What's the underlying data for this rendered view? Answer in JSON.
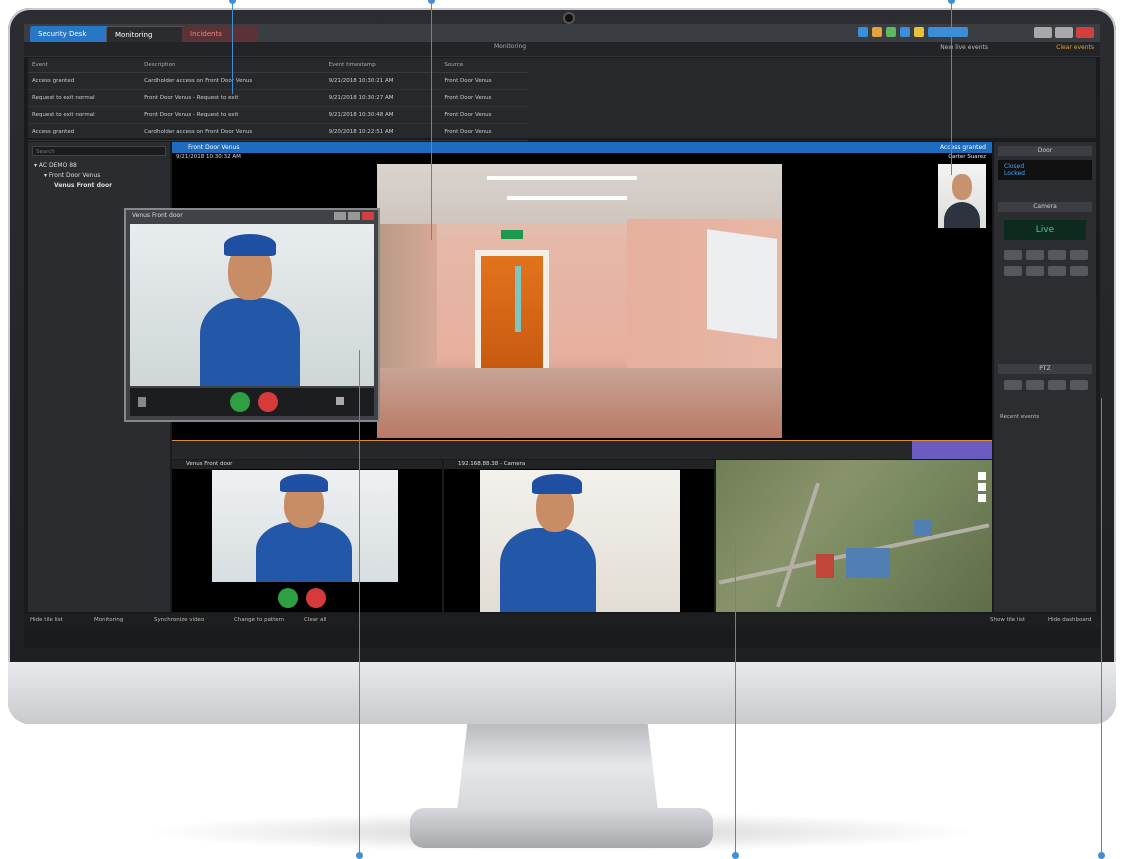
{
  "tabs": [
    {
      "label": "Security Desk"
    },
    {
      "label": "Monitoring"
    },
    {
      "label": "Incidents"
    }
  ],
  "subbar": {
    "title": "Monitoring",
    "btn1": "New live events",
    "btn2": "Clear events"
  },
  "events": {
    "headers": [
      "Event",
      "Description",
      "Event timestamp",
      "Source"
    ],
    "rows": [
      [
        "Access granted",
        "Cardholder access on Front Door Venus",
        "9/21/2018 10:30:21 AM",
        "Front Door Venus"
      ],
      [
        "Request to exit normal",
        "Front Door Venus - Request to exit",
        "9/21/2018 10:30:27 AM",
        "Front Door Venus"
      ],
      [
        "Request to exit normal",
        "Front Door Venus - Request to exit",
        "9/21/2018 10:30:48 AM",
        "Front Door Venus"
      ],
      [
        "Access granted",
        "Cardholder access on Front Door Venus",
        "9/20/2018 10:22:51 AM",
        "Front Door Venus"
      ]
    ]
  },
  "tree": {
    "search_placeholder": "Search",
    "items": [
      "AC DEMO 88",
      "Front Door Venus",
      "Venus Front door"
    ]
  },
  "mainview": {
    "header": "Front Door Venus",
    "timestamp": "9/21/2018 10:30:32 AM",
    "event_label": "Access granted",
    "event_person": "Carter Suarez"
  },
  "popup": {
    "title": "Venus Front door"
  },
  "tiles": [
    {
      "header": "Venus Front door"
    },
    {
      "header": "192.168.88.38 - Camera"
    },
    {
      "header": ""
    }
  ],
  "rightpanel": {
    "door_header": "Door",
    "door_state1": "Closed",
    "door_state2": "Locked",
    "camera_header": "Camera",
    "live_label": "Live",
    "ptz_header": "PTZ",
    "record_label": "Recent events"
  },
  "statusbar": {
    "item1": "Hide tile list",
    "item2": "Monitoring",
    "item3": "Synchronize video",
    "item4": "Change to pattern",
    "item5": "Clear all",
    "item6": "Show tile list",
    "item7": "Hide dashboard"
  },
  "colors": {
    "accent": "#2777c6",
    "callout": "#3e8fd6",
    "alert": "#d13f3f"
  }
}
